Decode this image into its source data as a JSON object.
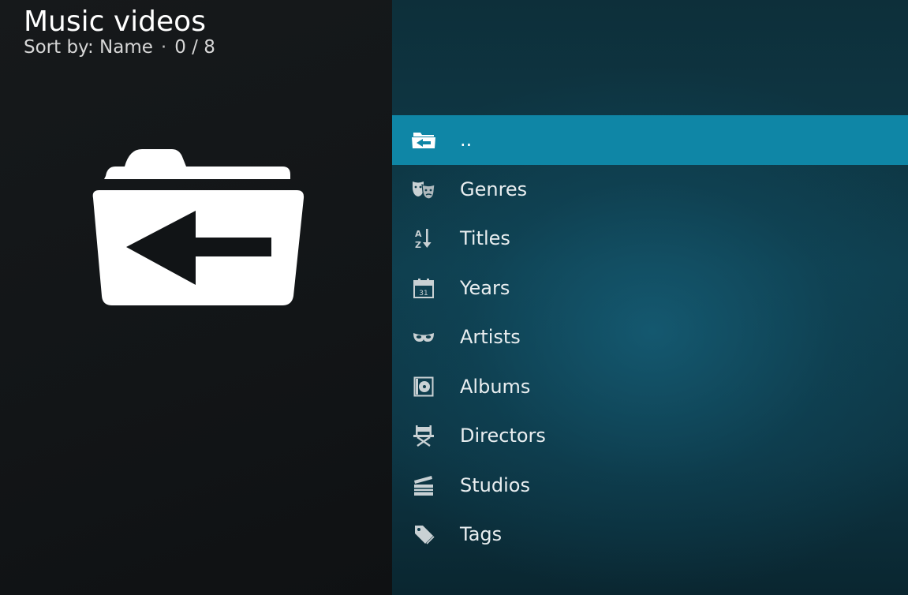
{
  "header": {
    "title": "Music videos",
    "sort_label": "Sort by: Name",
    "separator": "·",
    "position": "0 / 8"
  },
  "preview": {
    "icon": "folder-back-icon"
  },
  "colors": {
    "focus_bg": "#0f86a6",
    "left_bg": "#131618",
    "right_bg": "#0f3d4c"
  },
  "list": {
    "focused_index": 0,
    "items": [
      {
        "label": "..",
        "icon": "folder-back-icon"
      },
      {
        "label": "Genres",
        "icon": "theatre-masks-icon"
      },
      {
        "label": "Titles",
        "icon": "sort-az-icon"
      },
      {
        "label": "Years",
        "icon": "calendar-icon"
      },
      {
        "label": "Artists",
        "icon": "mask-icon"
      },
      {
        "label": "Albums",
        "icon": "album-icon"
      },
      {
        "label": "Directors",
        "icon": "director-chair-icon"
      },
      {
        "label": "Studios",
        "icon": "clapperboard-icon"
      },
      {
        "label": "Tags",
        "icon": "tag-icon"
      }
    ]
  },
  "calendar_day": "31"
}
